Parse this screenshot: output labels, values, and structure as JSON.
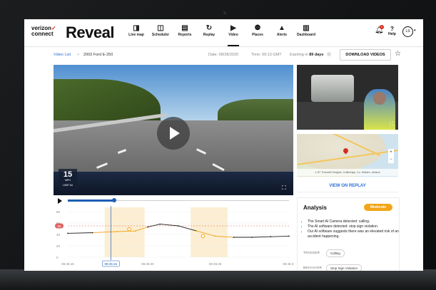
{
  "app": {
    "brand_line1": "verizon",
    "brand_line2": "connect",
    "brand_check": "✓",
    "product": "Reveal"
  },
  "nav": [
    {
      "label": "Live map",
      "icon": "map-icon",
      "glyph": "◨"
    },
    {
      "label": "Scheduler",
      "icon": "calendar-icon",
      "glyph": "◫"
    },
    {
      "label": "Reports",
      "icon": "report-icon",
      "glyph": "▤"
    },
    {
      "label": "Replay",
      "icon": "replay-icon",
      "glyph": "↻"
    },
    {
      "label": "Video",
      "icon": "video-icon",
      "glyph": "▶",
      "active": true
    },
    {
      "label": "Places",
      "icon": "places-icon",
      "glyph": "⚉"
    },
    {
      "label": "Alerts",
      "icon": "alert-icon",
      "glyph": "▲"
    },
    {
      "label": "Dashboard",
      "icon": "dashboard-icon",
      "glyph": "▥"
    }
  ],
  "header": {
    "notification_count": "1",
    "help_label": "Help",
    "avatar_initials": "LS"
  },
  "breadcrumb": {
    "link": "Video List",
    "separator": ">",
    "current": "2003 Ford E-250"
  },
  "video_meta": {
    "date_text": "Date: 08/28/2020",
    "time_text": "Time: 09:13 GMT",
    "expiring_prefix": "Expiring in",
    "expiring_value": "89 days",
    "download_label": "DOWNLOAD VIDEOS"
  },
  "speed": {
    "value": "15",
    "unit": "MPH",
    "limit": "LIMIT 64"
  },
  "map": {
    "caption": "1-57 Thornhill Heights, Collbridge, Co. Kildare, Ireland",
    "view_replay": "VIEW ON REPLAY"
  },
  "analysis": {
    "title": "Analysis",
    "severity": "Moderate",
    "items": [
      "The Smart AI Camera detected: calling.",
      "The AI software detected: stop sign violation.",
      "Our AI software suggests there was an elevated risk of an accident happening."
    ],
    "trigger_label": "TRIGGER",
    "trigger_value": "Calling",
    "trigger2_label": "BEHAVIOR",
    "trigger2_value": "Stop Sign Violation"
  },
  "colors": {
    "accent_red": "#d52b1e",
    "link_blue": "#2a6fd8",
    "moderate_orange": "#f2a516",
    "timeline_blue": "#1a5fb4"
  },
  "timeline": {
    "progress": 0.21
  },
  "chart_data": {
    "type": "line",
    "x_ticks": [
      "08:45:15",
      "08:45:16",
      "08:45:20",
      "08:45:25",
      "08:45:30"
    ],
    "y_ticks": [
      "80",
      "60",
      "40",
      "20",
      "0"
    ],
    "speed_limit": 55,
    "series": [
      {
        "values": [
          [
            0,
            42
          ],
          [
            4,
            43
          ],
          [
            8,
            45
          ],
          [
            11,
            46
          ],
          [
            13,
            53
          ],
          [
            15,
            58
          ],
          [
            18,
            55
          ],
          [
            21,
            46
          ],
          [
            24,
            37
          ],
          [
            27,
            35
          ],
          [
            30,
            35
          ],
          [
            33,
            36
          ],
          [
            36,
            37
          ]
        ]
      }
    ],
    "highlight_ranges": [
      [
        6,
        12.5
      ],
      [
        20,
        26
      ]
    ],
    "markers": [
      [
        10,
        49
      ],
      [
        22,
        37
      ]
    ],
    "cursor_x": 7
  }
}
